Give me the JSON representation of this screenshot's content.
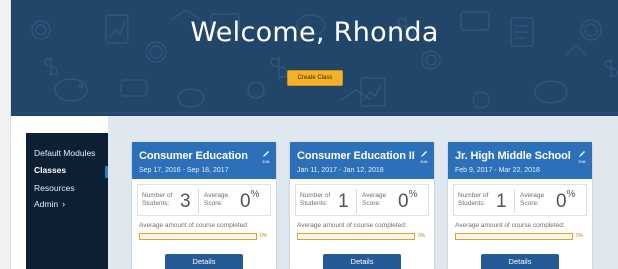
{
  "hero": {
    "greeting": "Welcome, Rhonda",
    "create_label": "Create Class"
  },
  "sidebar": {
    "items": [
      {
        "label": "Default Modules",
        "active": false
      },
      {
        "label": "Classes",
        "active": true
      },
      {
        "label": "Resources",
        "active": false
      },
      {
        "label": "Admin",
        "active": false,
        "icon": "chevron-right-icon"
      }
    ]
  },
  "cards": [
    {
      "title": "Consumer Education",
      "dates": "Sep 17, 2016 - Sep 18, 2017",
      "edit_label": "Edit",
      "students_label_1": "Number of",
      "students_label_2": "Students:",
      "students": "3",
      "score_label_1": "Average",
      "score_label_2": "Score:",
      "score": "0",
      "score_unit": "%",
      "progress_label": "Average amount of course completed:",
      "progress": "0%",
      "progress_fraction": 0,
      "details_label": "Details"
    },
    {
      "title": "Consumer Education II",
      "dates": "Jan 11, 2017 - Jan 12, 2018",
      "edit_label": "Edit",
      "students_label_1": "Number of",
      "students_label_2": "Students:",
      "students": "1",
      "score_label_1": "Average",
      "score_label_2": "Score:",
      "score": "0",
      "score_unit": "%",
      "progress_label": "Average amount of course completed:",
      "progress": "0%",
      "progress_fraction": 0,
      "details_label": "Details"
    },
    {
      "title": "Jr. High Middle School",
      "dates": "Feb 9, 2017 - Mar 22, 2018",
      "edit_label": "Edit",
      "students_label_1": "Number of",
      "students_label_2": "Students:",
      "students": "1",
      "score_label_1": "Average",
      "score_label_2": "Score:",
      "score": "0",
      "score_unit": "%",
      "progress_label": "Average amount of course completed:",
      "progress": "0%",
      "progress_fraction": 0,
      "details_label": "Details"
    }
  ],
  "colors": {
    "hero_bg": "#22466a",
    "accent_yellow": "#f3b229",
    "card_header": "#2b70b8",
    "sidebar_bg": "#0d1f33",
    "content_bg": "#dfe7ef"
  }
}
